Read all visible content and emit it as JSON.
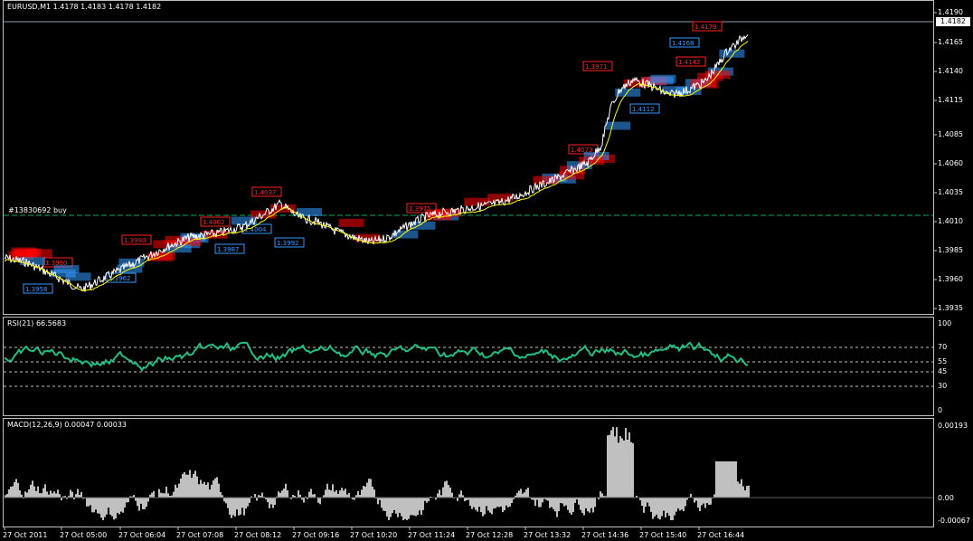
{
  "main": {
    "title": "EURUSD,M1  1.4178 1.4183 1.4178 1.4182",
    "order_label": "#13830692 buy",
    "current_price": "1.4182",
    "price_axis": [
      "1.4190",
      "1.4165",
      "1.4140",
      "1.4115",
      "1.4085",
      "1.4060",
      "1.4035",
      "1.4010",
      "1.3985",
      "1.3960",
      "1.3935"
    ],
    "red_labels": [
      "1.4179",
      "1.4142",
      "1.4073",
      "1.4037",
      "1.4002",
      "1.3990",
      "1.3980",
      "1.3975",
      "1.3971"
    ],
    "blue_labels": [
      "1.4168",
      "1.4112",
      "1.4004",
      "1.3992",
      "1.3987",
      "1.3962",
      "1.3958"
    ]
  },
  "rsi": {
    "title": "RSI(21) 66.5683",
    "axis": [
      "100",
      "70",
      "55",
      "45",
      "30",
      "0"
    ]
  },
  "macd": {
    "title": "MACD(12,26,9) 0.00047 0.00033",
    "axis": [
      "0.00193",
      "0.00",
      "-0.00067"
    ]
  },
  "time_axis": [
    "27 Oct 2011",
    "27 Oct 05:00",
    "27 Oct 06:04",
    "27 Oct 07:08",
    "27 Oct 08:12",
    "27 Oct 09:16",
    "27 Oct 10:20",
    "27 Oct 11:24",
    "27 Oct 12:28",
    "27 Oct 13:32",
    "27 Oct 14:36",
    "27 Oct 15:40",
    "27 Oct 16:44"
  ],
  "colors": {
    "background": "#000000",
    "grid": "#c0c0c0",
    "price_line": "#ffffff",
    "ma_line": "#ffff00",
    "red_label": "#ff0000",
    "blue_label": "#3399ff",
    "order_line": "#00aa66",
    "rsi_line": "#20c080",
    "macd_hist": "#c0c0c0",
    "macd_signal": "#20b080"
  }
}
